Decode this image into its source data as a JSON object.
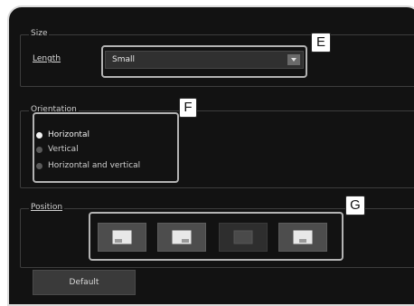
{
  "size": {
    "group_label": "Size",
    "length_label": "Length",
    "length_value": "Small",
    "callout_tag": "E"
  },
  "orientation": {
    "group_label": "Orientation",
    "options": [
      {
        "label": "Horizontal",
        "checked": true
      },
      {
        "label": "Vertical",
        "checked": false
      },
      {
        "label": "Horizontal and vertical",
        "checked": false
      }
    ],
    "callout_tag": "F"
  },
  "position": {
    "group_label": "Position",
    "buttons": [
      {
        "icon": "position-bottom-left-icon",
        "enabled": true
      },
      {
        "icon": "position-bottom-right-icon",
        "enabled": true
      },
      {
        "icon": "position-top-icon",
        "enabled": false
      },
      {
        "icon": "position-bottom-center-icon",
        "enabled": true
      }
    ],
    "callout_tag": "G"
  },
  "footer": {
    "default_label": "Default"
  }
}
